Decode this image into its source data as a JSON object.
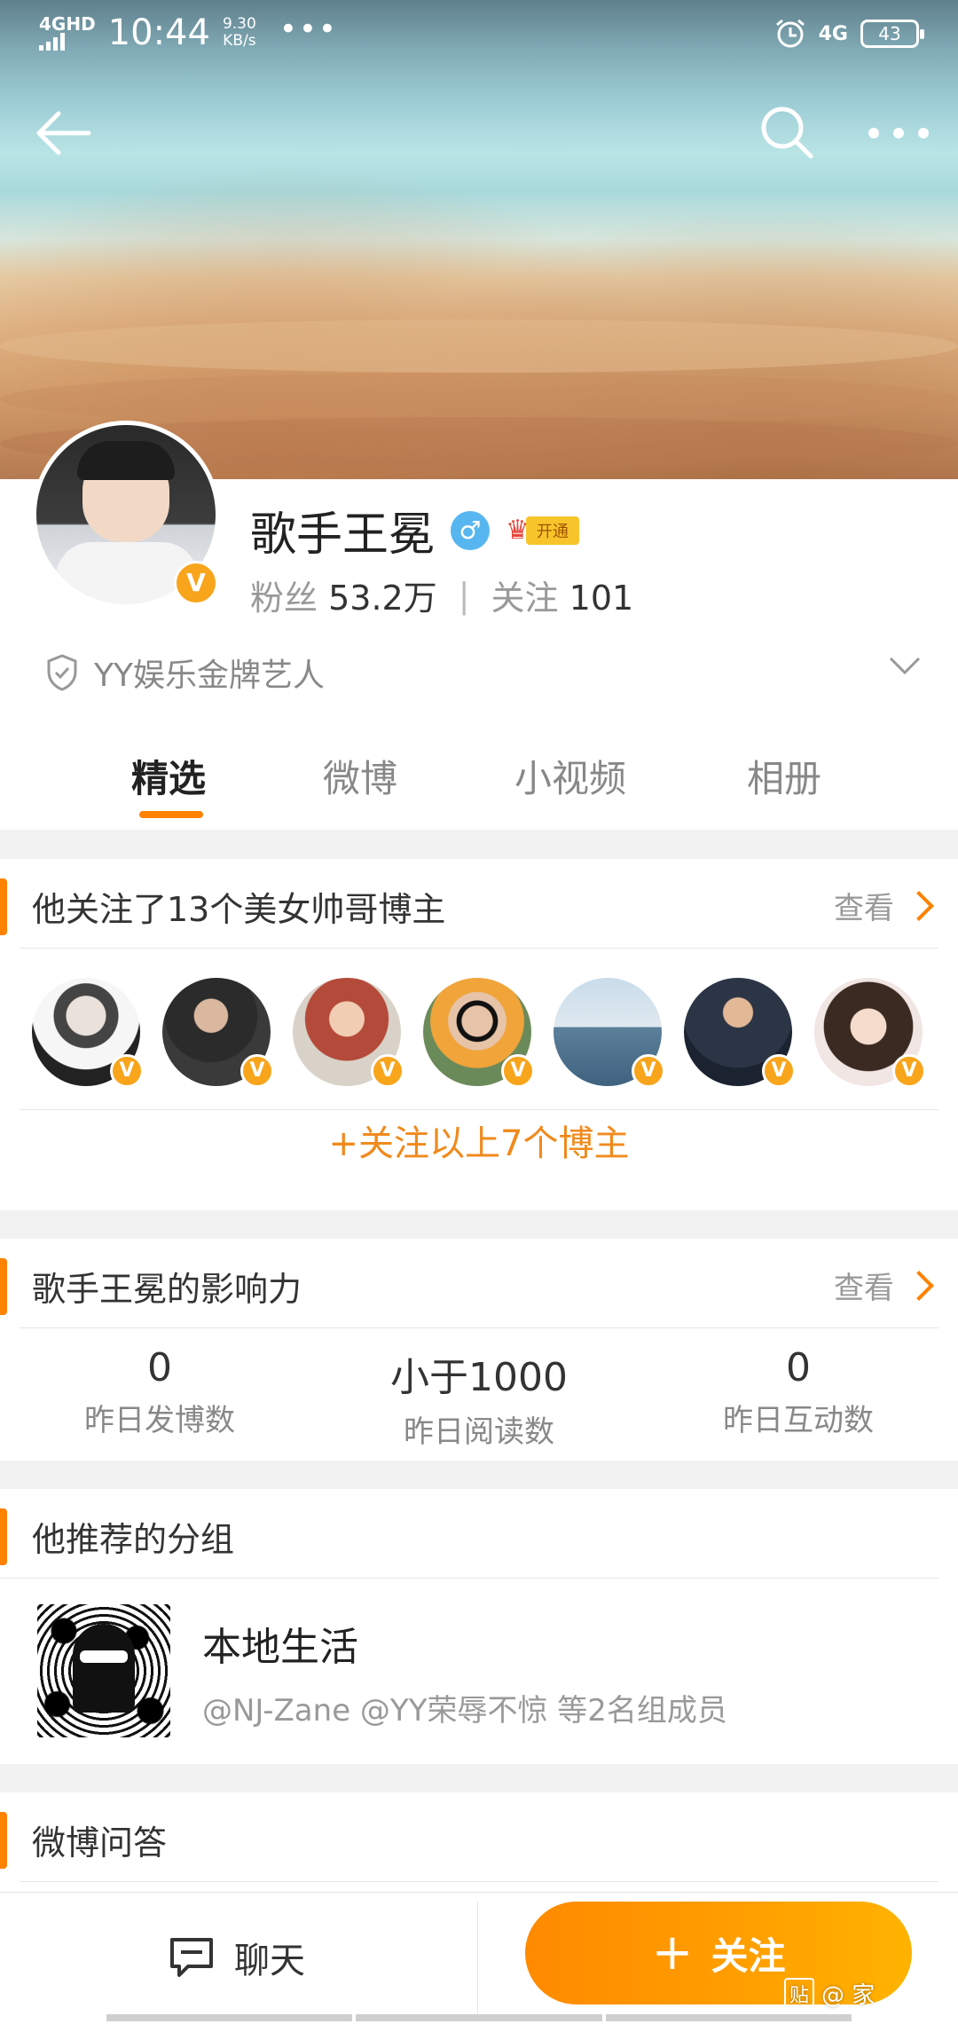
{
  "status_bar": {
    "network": "4GHD",
    "time": "10:44",
    "speed_value": "9.30",
    "speed_unit": "KB/s",
    "overflow": "•••",
    "network_right": "4G",
    "battery": "43"
  },
  "profile": {
    "name": "歌手王冕",
    "gender_symbol": "♂",
    "vip_tag": "开通",
    "fans_label": "粉丝",
    "fans_value": "53.2万",
    "follow_label": "关注",
    "follow_value": "101",
    "verification": "YY娱乐金牌艺人",
    "badge_letter": "V"
  },
  "tabs": [
    {
      "label": "精选",
      "active": true
    },
    {
      "label": "微博",
      "active": false
    },
    {
      "label": "小视频",
      "active": false
    },
    {
      "label": "相册",
      "active": false
    }
  ],
  "following_card": {
    "title": "他关注了13个美女帅哥博主",
    "link": "查看",
    "follow_all": "+关注以上7个博主",
    "avatar_count": 7
  },
  "influence_card": {
    "title": "歌手王冕的影响力",
    "link": "查看",
    "metrics": [
      {
        "value": "0",
        "label": "昨日发博数"
      },
      {
        "value": "小于1000",
        "label": "昨日阅读数"
      },
      {
        "value": "0",
        "label": "昨日互动数"
      }
    ]
  },
  "groups_card": {
    "title": "他推荐的分组",
    "group_name": "本地生活",
    "group_members": "@NJ-Zane @YY荣辱不惊 等2名组成员"
  },
  "qa_card": {
    "title": "微博问答"
  },
  "bottom_bar": {
    "chat": "聊天",
    "follow": "关注",
    "watermark_box": "贴",
    "watermark_text": "@ 家"
  },
  "colors": {
    "accent": "#ff8200",
    "verified_badge": "#f8a51c",
    "gender": "#57b6ef"
  }
}
